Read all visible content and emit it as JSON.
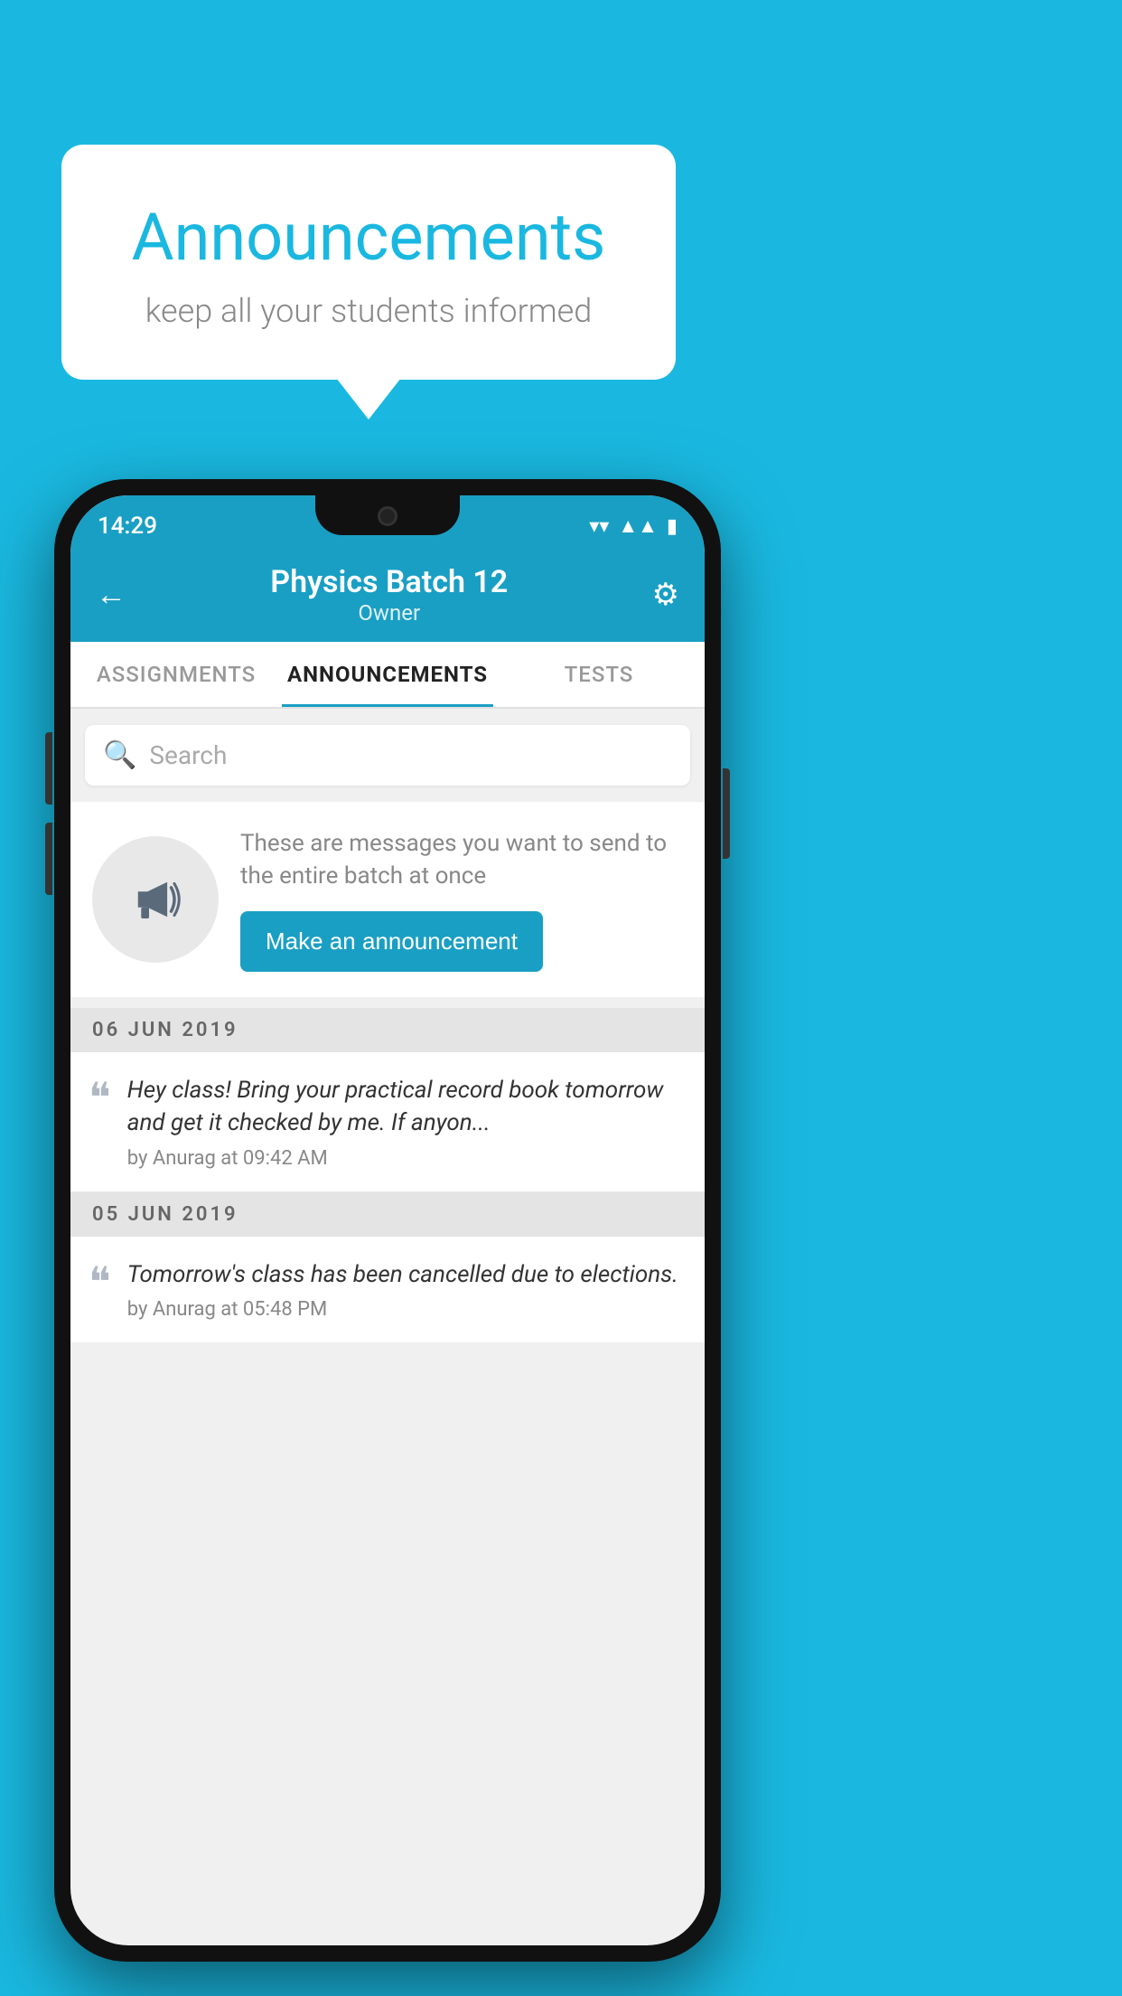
{
  "background_color": "#1ab8e0",
  "speech_bubble": {
    "title": "Announcements",
    "subtitle": "keep all your students informed"
  },
  "phone": {
    "status_bar": {
      "time": "14:29",
      "icons": [
        "wifi",
        "signal",
        "battery"
      ]
    },
    "header": {
      "back_label": "←",
      "title": "Physics Batch 12",
      "subtitle": "Owner",
      "gear_label": "⚙"
    },
    "tabs": [
      {
        "label": "ASSIGNMENTS",
        "active": false
      },
      {
        "label": "ANNOUNCEMENTS",
        "active": true
      },
      {
        "label": "TESTS",
        "active": false
      }
    ],
    "search": {
      "placeholder": "Search"
    },
    "promo": {
      "description": "These are messages you want to send to the entire batch at once",
      "button_label": "Make an announcement"
    },
    "announcements": [
      {
        "date": "06  JUN  2019",
        "text": "Hey class! Bring your practical record book tomorrow and get it checked by me. If anyon...",
        "meta": "by Anurag at 09:42 AM"
      },
      {
        "date": "05  JUN  2019",
        "text": "Tomorrow's class has been cancelled due to elections.",
        "meta": "by Anurag at 05:48 PM"
      }
    ]
  }
}
